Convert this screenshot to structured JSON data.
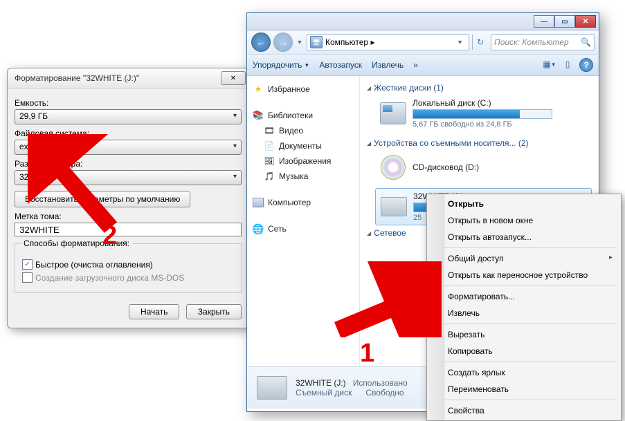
{
  "format": {
    "title": "Форматирование \"32WHITE (J:)\"",
    "capacity_label": "Емкость:",
    "capacity_value": "29,9 ГБ",
    "filesystem_label": "Файловая система:",
    "filesystem_value": "exFAT",
    "cluster_label": "Размер кластера:",
    "cluster_value": "32 КБ",
    "restore_defaults": "Восстановить параметры по умолчанию",
    "volume_label_label": "Метка тома:",
    "volume_label_value": "32WHITE",
    "methods_group": "Способы форматирования:",
    "quick_format": "Быстрое (очистка оглавления)",
    "msdos_boot": "Создание загрузочного диска MS-DOS",
    "start_btn": "Начать",
    "close_btn": "Закрыть"
  },
  "explorer": {
    "address": "Компьютер ▸",
    "search_placeholder": "Поиск: Компьютер",
    "toolbar": {
      "organize": "Упорядочить",
      "autorun": "Автозапуск",
      "eject": "Извлечь"
    },
    "sidebar": {
      "favorites": "Избранное",
      "libraries": "Библиотеки",
      "video": "Видео",
      "documents": "Документы",
      "pictures": "Изображения",
      "music": "Музыка",
      "computer": "Компьютер",
      "network": "Сеть"
    },
    "sections": {
      "hdd": "Жесткие диски (1)",
      "removable": "Устройства со съемными носителя... (2)",
      "netloc": "Сетевое "
    },
    "drives": {
      "local": {
        "name": "Локальный диск (C:)",
        "free_text": "5,67 ГБ свободно из 24,8 ГБ",
        "fill_pct": 77
      },
      "dvd": {
        "name": "CD-дисковод (D:)"
      },
      "usb": {
        "name": "32WHITE (J:)",
        "free_text": "25",
        "fill_pct": 15
      }
    },
    "status": {
      "name": "32WHITE (J:)",
      "type": "Съемный диск",
      "used_label": "Использовано",
      "free_label": "Свободно"
    }
  },
  "ctx": {
    "open": "Открыть",
    "open_new": "Открыть в новом окне",
    "open_autorun": "Открыть автозапуск...",
    "share": "Общий доступ",
    "portable": "Открыть как переносное устройство",
    "format": "Форматировать...",
    "eject": "Извлечь",
    "cut": "Вырезать",
    "copy": "Копировать",
    "shortcut": "Создать ярлык",
    "rename": "Переименовать",
    "properties": "Свойства"
  },
  "annot": {
    "one": "1",
    "two": "2"
  }
}
